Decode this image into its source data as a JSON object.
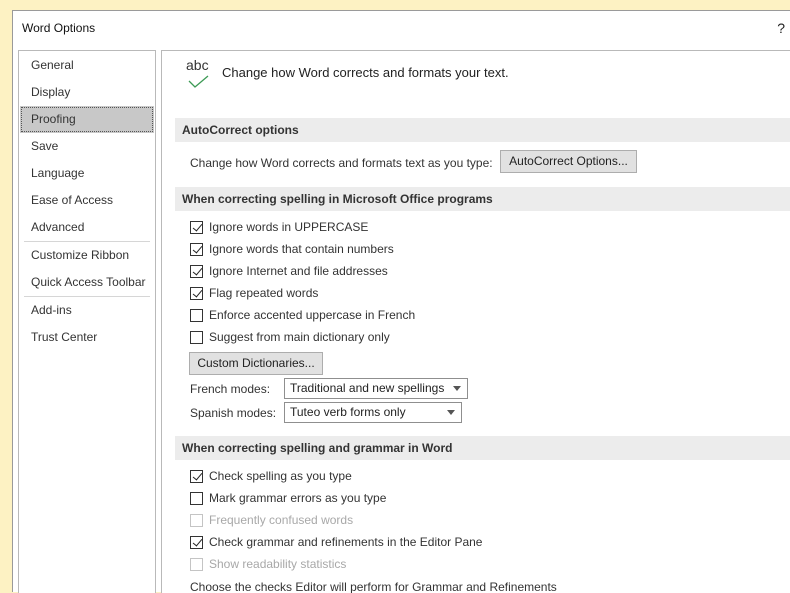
{
  "window": {
    "title": "Word Options",
    "help_label": "?"
  },
  "sidebar": {
    "groups": [
      [
        {
          "label": "General"
        },
        {
          "label": "Display"
        },
        {
          "label": "Proofing",
          "selected": true
        },
        {
          "label": "Save"
        },
        {
          "label": "Language"
        },
        {
          "label": "Ease of Access"
        },
        {
          "label": "Advanced"
        }
      ],
      [
        {
          "label": "Customize Ribbon"
        },
        {
          "label": "Quick Access Toolbar"
        }
      ],
      [
        {
          "label": "Add-ins"
        },
        {
          "label": "Trust Center"
        }
      ]
    ]
  },
  "intro": {
    "icon_text": "abc",
    "text": "Change how Word corrects and formats your text."
  },
  "autocorrect": {
    "header": "AutoCorrect options",
    "description": "Change how Word corrects and formats text as you type:",
    "button_label": "AutoCorrect Options..."
  },
  "office_spelling": {
    "header": "When correcting spelling in Microsoft Office programs",
    "options": [
      {
        "label": "Ignore words in UPPERCASE",
        "checked": true
      },
      {
        "label": "Ignore words that contain numbers",
        "checked": true
      },
      {
        "label": "Ignore Internet and file addresses",
        "checked": true
      },
      {
        "label": "Flag repeated words",
        "checked": true
      },
      {
        "label": "Enforce accented uppercase in French",
        "checked": false
      },
      {
        "label": "Suggest from main dictionary only",
        "checked": false
      }
    ],
    "custom_dict_button": "Custom Dictionaries...",
    "french_modes_label": "French modes:",
    "french_modes_value": "Traditional and new spellings",
    "spanish_modes_label": "Spanish modes:",
    "spanish_modes_value": "Tuteo verb forms only"
  },
  "word_spelling": {
    "header": "When correcting spelling and grammar in Word",
    "options": [
      {
        "label": "Check spelling as you type",
        "checked": true,
        "disabled": false
      },
      {
        "label": "Mark grammar errors as you type",
        "checked": false,
        "disabled": false
      },
      {
        "label": "Frequently confused words",
        "checked": false,
        "disabled": true
      },
      {
        "label": "Check grammar and refinements in the Editor Pane",
        "checked": true,
        "disabled": false
      },
      {
        "label": "Show readability statistics",
        "checked": false,
        "disabled": true
      }
    ],
    "checks_description": "Choose the checks Editor will perform for Grammar and Refinements"
  },
  "colors": {
    "desktop_background": "#fdf2c3",
    "selected_nav": "#c8c8c8",
    "section_header_bg": "#ececec",
    "check_green": "#3c9a55"
  }
}
